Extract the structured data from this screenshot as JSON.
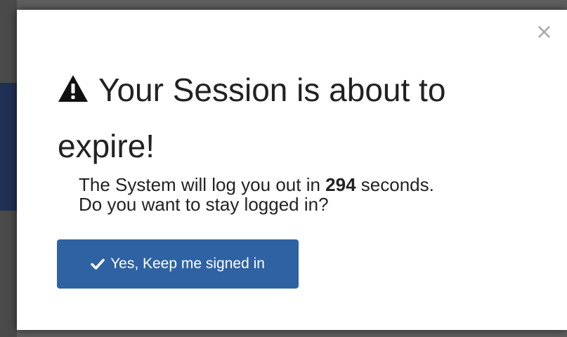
{
  "dialog": {
    "close_label": "×",
    "title": "Your Session is about to expire!",
    "message_prefix": "The System will log you out in ",
    "countdown_seconds": "294",
    "message_suffix": " seconds.",
    "message_line2": "Do you want to stay logged in?",
    "confirm_button_label": "Yes, Keep me signed in",
    "title_icon": "warning-icon",
    "confirm_icon": "check-icon",
    "confirm_button_color": "#2e62a3"
  }
}
